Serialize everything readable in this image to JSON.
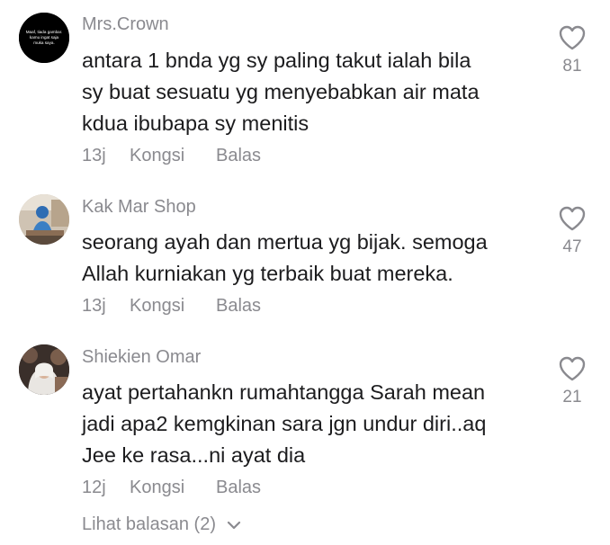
{
  "comments": [
    {
      "username": "Mrs.Crown",
      "text": "antara 1 bnda yg sy paling takut ialah bila\nsy buat sesuatu yg menyebabkan air mata\nkdua ibubapa sy menitis",
      "time": "13j",
      "share_label": "Kongsi",
      "reply_label": "Balas",
      "likes": "81",
      "avatar_text": "Maaf, tiada gambar.\nkamu ingat saja\nmuka saya."
    },
    {
      "username": "Kak Mar Shop",
      "text": "seorang ayah dan mertua yg bijak. semoga\nAllah kurniakan yg terbaik buat mereka.",
      "time": "13j",
      "share_label": "Kongsi",
      "reply_label": "Balas",
      "likes": "47"
    },
    {
      "username": "Shiekien Omar",
      "text": "ayat pertahankn rumahtangga Sarah mean\njadi apa2 kemgkinan sara jgn undur diri..aq\nJee ke rasa...ni ayat dia",
      "time": "12j",
      "share_label": "Kongsi",
      "reply_label": "Balas",
      "likes": "21"
    }
  ],
  "view_replies_label": "Lihat balasan (2)",
  "icons": {
    "like": "heart-outline-icon",
    "expand": "chevron-down-icon"
  },
  "colors": {
    "text": "#1c1c1e",
    "secondary": "#8a8a8f",
    "background": "#ffffff"
  }
}
